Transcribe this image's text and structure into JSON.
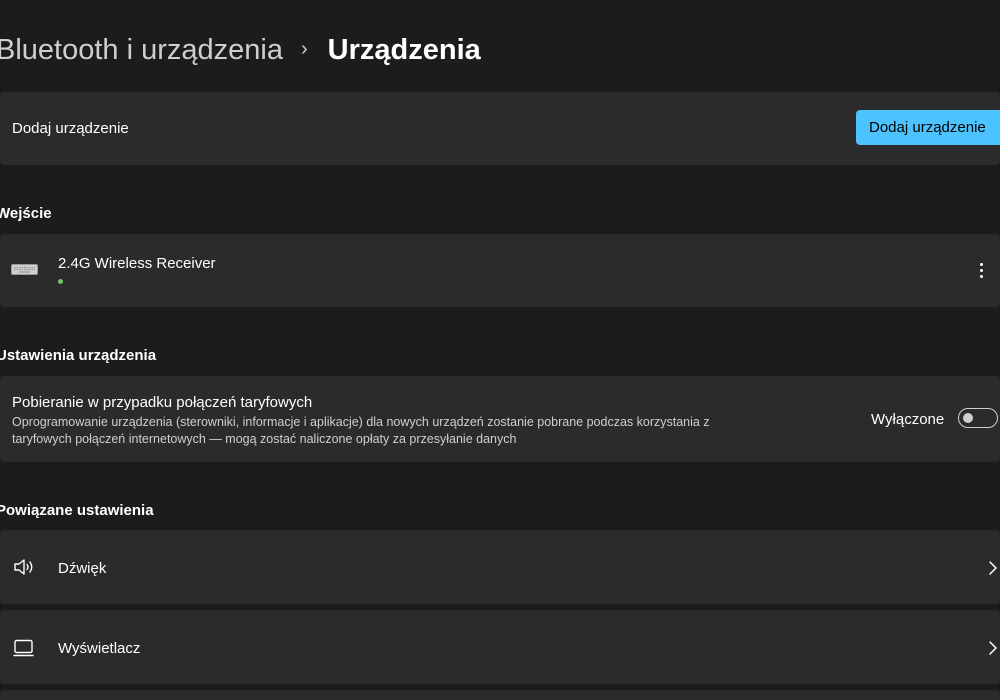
{
  "header": {
    "parent": "Bluetooth i urządzenia",
    "separator": "›",
    "current": "Urządzenia"
  },
  "add_device": {
    "label": "Dodaj urządzenie",
    "button_label": "Dodaj urządzenie"
  },
  "input_section": {
    "title": "Wejście",
    "devices": [
      {
        "name": "2.4G Wireless Receiver",
        "icon": "keyboard-icon",
        "status": "connected"
      }
    ]
  },
  "device_settings": {
    "title": "Ustawienia urządzenia",
    "metered": {
      "title": "Pobieranie w przypadku połączeń taryfowych",
      "description": "Oprogramowanie urządzenia (sterowniki, informacje i aplikacje) dla nowych urządzeń zostanie pobrane podczas korzystania z taryfowych połączeń internetowych — mogą zostać naliczone opłaty za przesyłanie danych",
      "toggle_label": "Wyłączone",
      "toggle_on": false
    }
  },
  "related": {
    "title": "Powiązane ustawienia",
    "items": [
      {
        "label": "Dźwięk",
        "icon": "speaker-icon"
      },
      {
        "label": "Wyświetlacz",
        "icon": "monitor-icon"
      }
    ]
  },
  "colors": {
    "background": "#1c1c1c",
    "card": "#2b2b2b",
    "accent": "#4cc2ff",
    "status_green": "#6ccb5f"
  }
}
